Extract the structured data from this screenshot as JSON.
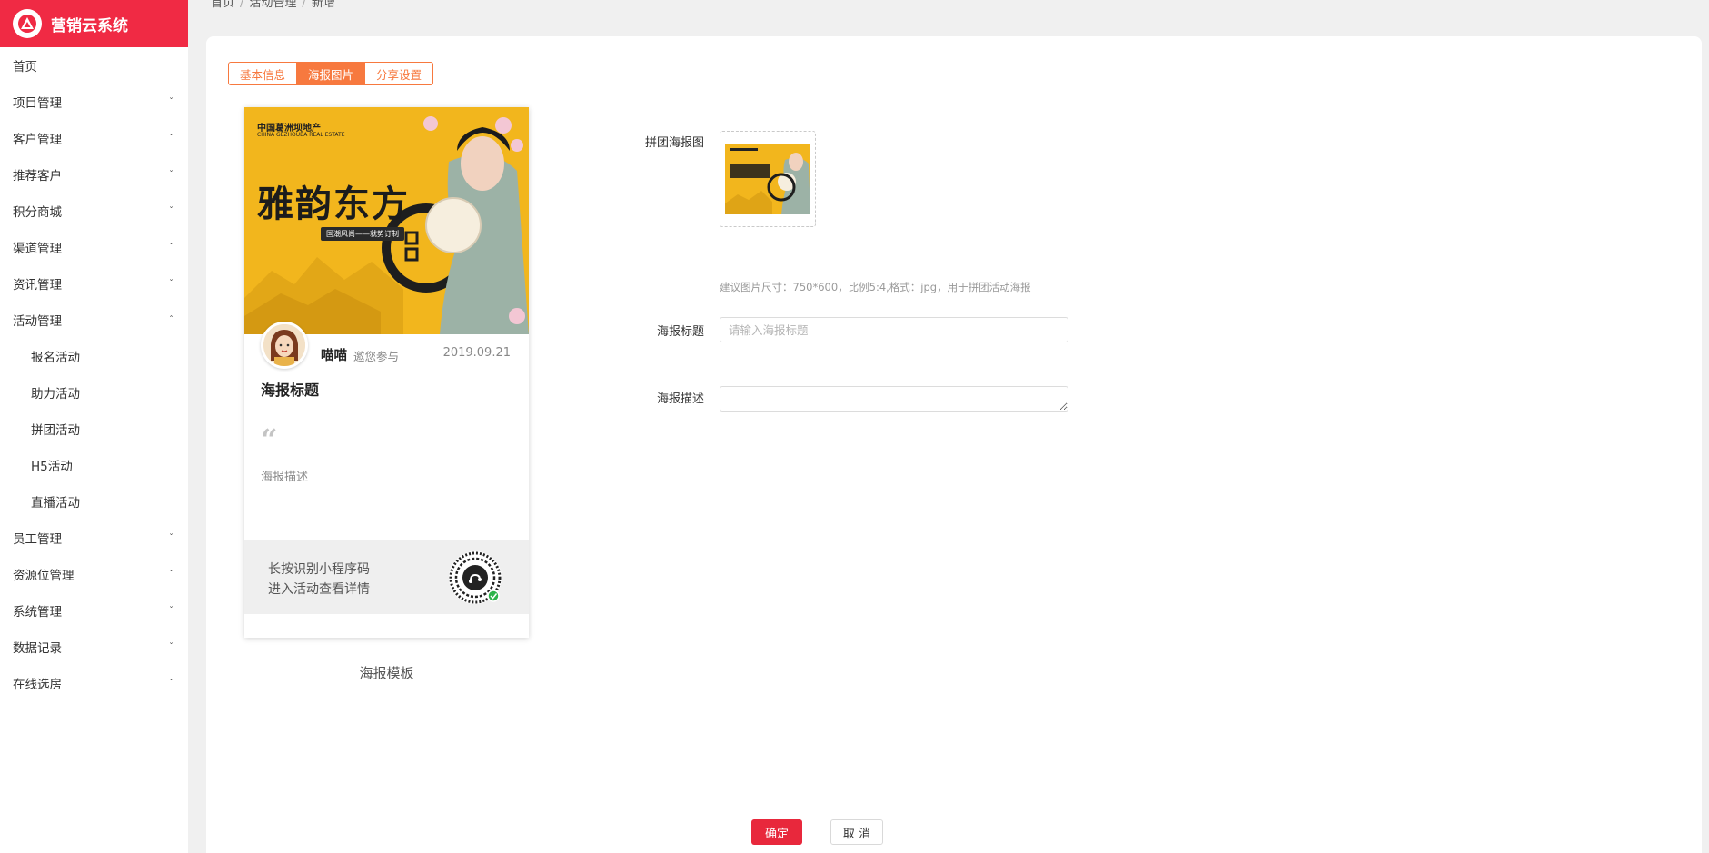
{
  "app": {
    "title": "营销云系统",
    "brand_color": "#f02a44",
    "accent_color": "#f7793f"
  },
  "sidebar": {
    "items": [
      {
        "label": "首页",
        "expandable": false
      },
      {
        "label": "项目管理",
        "expandable": true
      },
      {
        "label": "客户管理",
        "expandable": true
      },
      {
        "label": "推荐客户",
        "expandable": true
      },
      {
        "label": "积分商城",
        "expandable": true
      },
      {
        "label": "渠道管理",
        "expandable": true
      },
      {
        "label": "资讯管理",
        "expandable": true
      },
      {
        "label": "活动管理",
        "expandable": true,
        "expanded": true,
        "children": [
          "报名活动",
          "助力活动",
          "拼团活动",
          "H5活动",
          "直播活动"
        ]
      },
      {
        "label": "员工管理",
        "expandable": true
      },
      {
        "label": "资源位管理",
        "expandable": true
      },
      {
        "label": "系统管理",
        "expandable": true
      },
      {
        "label": "数据记录",
        "expandable": true
      },
      {
        "label": "在线选房",
        "expandable": true
      }
    ],
    "chevron_down": "ˇ",
    "chevron_up": "ˆ"
  },
  "breadcrumb": [
    "首页",
    "活动管理",
    "新增"
  ],
  "tabs": [
    {
      "label": "基本信息",
      "active": false
    },
    {
      "label": "海报图片",
      "active": true
    },
    {
      "label": "分享设置",
      "active": false
    }
  ],
  "poster": {
    "banner": {
      "company": "中国葛洲坝地产",
      "company_en": "CHINA GEZHOUBA REAL ESTATE",
      "headline": "雅韵东方",
      "tag": "国潮风尚——就势订制"
    },
    "user_name": "喵喵",
    "invite_text": "邀您参与",
    "date": "2019.09.21",
    "title": "海报标题",
    "quote_mark": "“",
    "description": "海报描述",
    "footer_line1": "长按识别小程序码",
    "footer_line2": "进入活动查看详情",
    "caption": "海报模板"
  },
  "form": {
    "group_poster_label": "拼团海报图",
    "hint": "建议图片尺寸：750*600，比例5:4,格式：jpg，用于拼团活动海报",
    "title_label": "海报标题",
    "title_placeholder": "请输入海报标题",
    "title_value": "",
    "desc_label": "海报描述",
    "desc_value": ""
  },
  "actions": {
    "confirm": "确定",
    "cancel": "取 消"
  }
}
